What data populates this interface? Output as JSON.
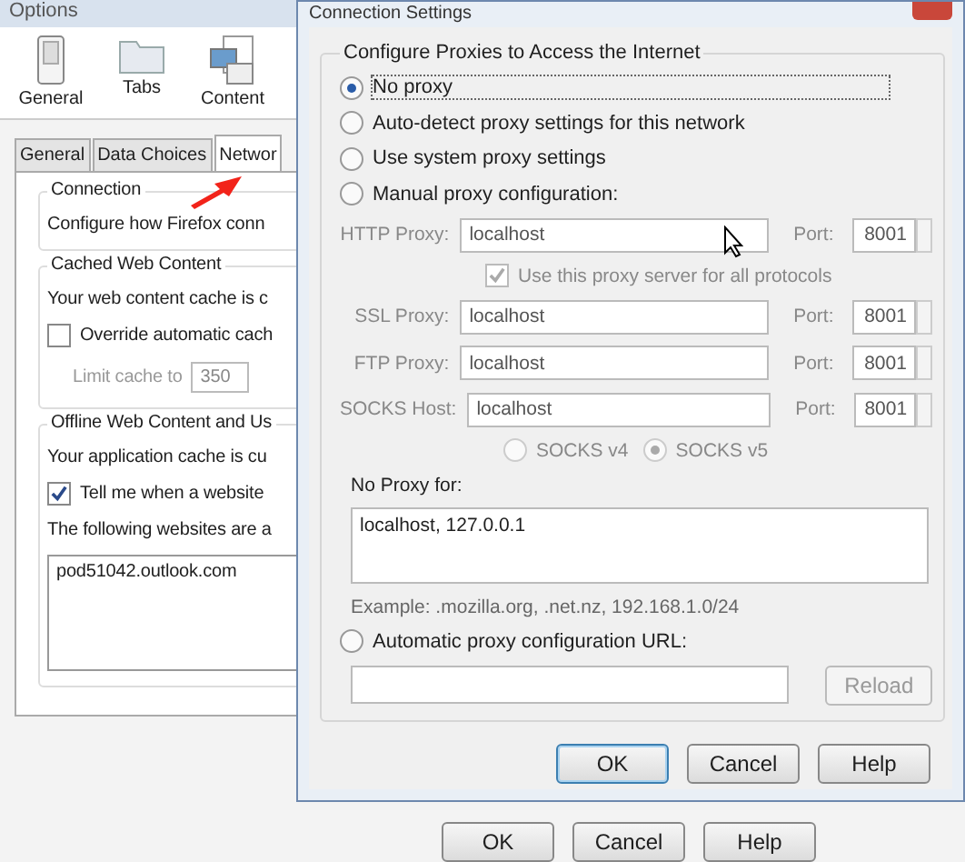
{
  "options_window": {
    "title": "Options",
    "toolbar": [
      {
        "label": "General"
      },
      {
        "label": "Tabs"
      },
      {
        "label": "Content"
      }
    ],
    "tabs": [
      {
        "label": "General",
        "selected": false
      },
      {
        "label": "Data Choices",
        "selected": false
      },
      {
        "label": "Networ",
        "selected": true
      }
    ],
    "connection": {
      "heading": "Connection",
      "text": "Configure how Firefox conn"
    },
    "cache": {
      "heading": "Cached Web Content",
      "text": "Your web content cache is c",
      "override": {
        "label": "Override automatic cach",
        "checked": false
      },
      "limit_label": "Limit cache to",
      "limit_value": "350",
      "limit_disabled": true
    },
    "offline": {
      "heading": "Offline Web Content and Us",
      "text": "Your application cache is cu",
      "tell_me": {
        "label": "Tell me when a website",
        "checked": true
      },
      "list_label": "The following websites are a",
      "sites": [
        "pod51042.outlook.com"
      ]
    },
    "buttons": [
      "OK",
      "Cancel",
      "Help"
    ]
  },
  "dialog": {
    "title": "Connection Settings",
    "group": "Configure Proxies to Access the Internet",
    "modes": [
      {
        "label": "No proxy",
        "selected": true
      },
      {
        "label": "Auto-detect proxy settings for this network",
        "selected": false
      },
      {
        "label": "Use system proxy settings",
        "selected": false
      },
      {
        "label": "Manual proxy configuration:",
        "selected": false
      },
      {
        "label": "Automatic proxy configuration URL:",
        "selected": false
      }
    ],
    "proxies": [
      {
        "label": "HTTP Proxy:",
        "value": "localhost",
        "port_label": "Port:",
        "port": "8001",
        "disabled": true
      },
      {
        "label": "SSL Proxy:",
        "value": "localhost",
        "port_label": "Port:",
        "port": "8001",
        "disabled": true
      },
      {
        "label": "FTP Proxy:",
        "value": "localhost",
        "port_label": "Port:",
        "port": "8001",
        "disabled": true
      },
      {
        "label": "SOCKS Host:",
        "value": "localhost",
        "port_label": "Port:",
        "port": "8001",
        "disabled": true
      }
    ],
    "share": {
      "label": "Use this proxy server for all protocols",
      "checked": true,
      "disabled": true
    },
    "socks_versions": [
      {
        "label": "SOCKS v4",
        "selected": false,
        "disabled": true
      },
      {
        "label": "SOCKS v5",
        "selected": true,
        "disabled": true
      }
    ],
    "no_proxy_label": "No Proxy for:",
    "no_proxy_value": "localhost, 127.0.0.1",
    "example": "Example: .mozilla.org, .net.nz, 192.168.1.0/24",
    "reload": {
      "label": "Reload",
      "disabled": true
    },
    "buttons": [
      {
        "label": "OK",
        "default": true
      },
      {
        "label": "Cancel",
        "default": false
      },
      {
        "label": "Help",
        "default": false
      }
    ]
  }
}
